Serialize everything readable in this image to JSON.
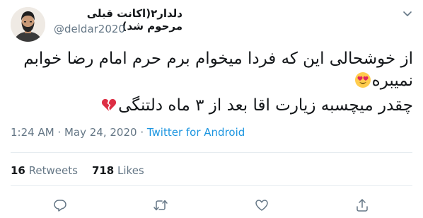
{
  "user": {
    "display_name": "دلدار۲(اکانت قبلی مرحوم شد)",
    "handle": "@deldar2020"
  },
  "tweet": {
    "line1": "از خوشحالی این که فردا میخوام برم حرم امام رضا خوابم",
    "line2_text": "نمیبره",
    "line2_emoji": "heart-eyes-emoji",
    "line3_text": "چقدر میچسبه زیارت اقا بعد از ۳ ماه دلتنگی",
    "line3_emoji": "broken-heart-emoji"
  },
  "meta": {
    "time": "1:24 AM",
    "separator": " · ",
    "date": "May 24, 2020",
    "source": "Twitter for Android"
  },
  "stats": {
    "retweets_count": "16",
    "retweets_label": "Retweets",
    "likes_count": "718",
    "likes_label": "Likes"
  },
  "icons": {
    "more": "chevron-down-icon",
    "reply": "reply-icon",
    "retweet": "retweet-icon",
    "like": "heart-icon",
    "share": "share-icon"
  },
  "colors": {
    "text": "#14171a",
    "secondary": "#657786",
    "link": "#1b95e0",
    "divider": "#e6ecf0"
  }
}
